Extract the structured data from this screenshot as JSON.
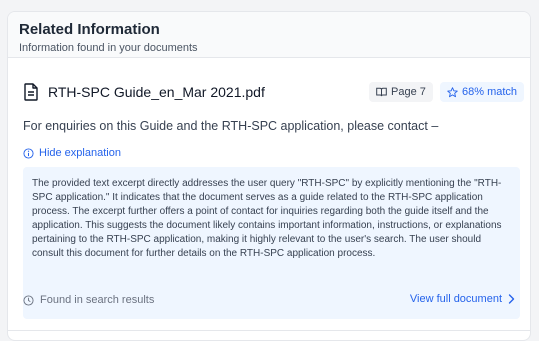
{
  "panel": {
    "title": "Related Information",
    "subtitle": "Information found in your documents"
  },
  "result": {
    "doc_title": "RTH-SPC Guide_en_Mar 2021.pdf",
    "doc_icon": "document-icon",
    "page_label": "Page 7",
    "match_label": "68% match",
    "excerpt": "For enquiries on this Guide and the RTH-SPC application, please contact –",
    "toggle_label": "Hide explanation",
    "explanation": "The provided text excerpt directly addresses the user query \"RTH-SPC\" by explicitly mentioning the \"RTH-SPC application.\" It indicates that the document serves as a guide related to the RTH-SPC application process. The excerpt further offers a point of contact for inquiries regarding both the guide itself and the application. This suggests the document likely contains important information, instructions, or explanations pertaining to the RTH-SPC application, making it highly relevant to the user's search. The user should consult this document for further details on the RTH-SPC application process.",
    "found_label": "Found in search results",
    "view_full_label": "View full document"
  },
  "colors": {
    "accent": "#2563eb",
    "explanation_bg": "#eff6ff",
    "header_bg": "#f9fafb"
  }
}
